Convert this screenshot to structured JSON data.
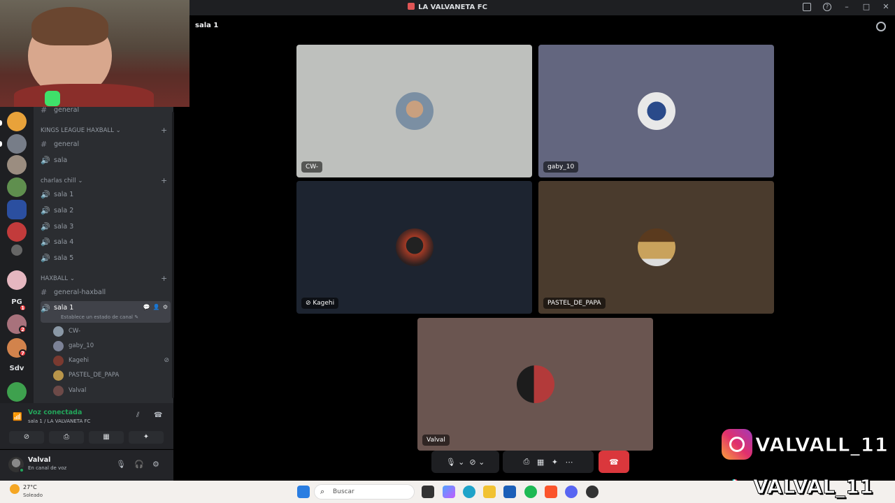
{
  "window": {
    "title": "LA VALVANETA FC",
    "controls": [
      "–",
      "□",
      "✕"
    ]
  },
  "servers": [
    {
      "icon": "crown-server-icon",
      "color": "#e8a23a"
    },
    {
      "icon": "server-icon",
      "color": "#777d88"
    },
    {
      "icon": "dog-server-icon",
      "color": "#9b8d80"
    },
    {
      "icon": "game-server-icon",
      "color": "#5f8f4e"
    },
    {
      "icon": "poster-server-icon",
      "color": "#2b4fa0"
    },
    {
      "icon": "football-server-icon",
      "color": "#c23b3b"
    },
    {
      "icon": "photo-server-icon",
      "color": "#666"
    },
    {
      "icon": "pig-server-icon",
      "color": "#e5b7c0"
    },
    {
      "icon": "text-server-icon",
      "label": "PG",
      "badge": "1"
    },
    {
      "icon": "mixed-server-icon",
      "color": "#a8727c",
      "badge": "2"
    },
    {
      "icon": "sunset-server-icon",
      "color": "#d2834c",
      "badge": "7"
    },
    {
      "icon": "text-server-icon",
      "label": "Sdv"
    },
    {
      "icon": "skull-server-icon",
      "color": "#3ea14e"
    }
  ],
  "channels": {
    "top_channel": "general",
    "categories": [
      {
        "name": "KINGS LEAGUE HAXBALL",
        "channels": [
          {
            "type": "text",
            "name": "general"
          },
          {
            "type": "voice",
            "name": "sala"
          }
        ]
      },
      {
        "name": "charlas chill",
        "channels": [
          {
            "type": "voice",
            "name": "sala 1"
          },
          {
            "type": "voice",
            "name": "sala 2"
          },
          {
            "type": "voice",
            "name": "sala 3"
          },
          {
            "type": "voice",
            "name": "sala 4"
          },
          {
            "type": "voice",
            "name": "sala 5"
          }
        ]
      },
      {
        "name": "HAXBALL",
        "channels": [
          {
            "type": "text",
            "name": "general-haxball"
          },
          {
            "type": "voice",
            "name": "sala 1"
          }
        ]
      }
    ],
    "active_status_placeholder": "Establece un estado de canal",
    "voice_users": [
      {
        "name": "CW-",
        "color": "#8a98a6"
      },
      {
        "name": "gaby_10",
        "color": "#7c8296"
      },
      {
        "name": "Kagehi",
        "color": "#7a3a30",
        "muted": true
      },
      {
        "name": "PASTEL_DE_PAPA",
        "color": "#b8954a"
      },
      {
        "name": "Valval",
        "color": "#6d4a48"
      }
    ]
  },
  "voice_panel": {
    "title": "Voz conectada",
    "subtitle": "sala 1 / LA VALVANETA FC"
  },
  "user_panel": {
    "name": "Valval",
    "status": "En canal de voz"
  },
  "stage": {
    "channel": "sala 1",
    "tiles": [
      {
        "name": "CW-",
        "bg": "#bec0bd",
        "avatar": "#7b8fa3"
      },
      {
        "name": "gaby_10",
        "bg": "#63667f",
        "avatar": "#e8e8e8"
      },
      {
        "name": "Kagehi",
        "bg": "#1d2430",
        "avatar": "#a33a25",
        "muted": true
      },
      {
        "name": "PASTEL_DE_PAPA",
        "bg": "#4a3b2d",
        "avatar": "#c9a25c"
      },
      {
        "name": "Valval",
        "bg": "#6a5550",
        "avatar": "#3b3233"
      }
    ]
  },
  "overlay": {
    "instagram": "VALVALL_11",
    "tiktok": "VALVAL_11"
  },
  "taskbar": {
    "temp": "27°C",
    "weather": "Soleado",
    "search_placeholder": "Buscar"
  }
}
